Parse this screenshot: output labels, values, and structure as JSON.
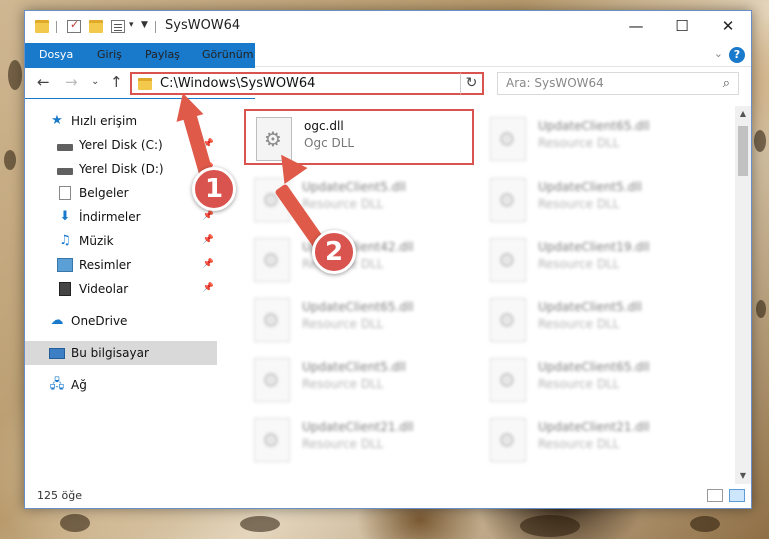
{
  "window": {
    "title": "SysWOW64",
    "controls": {
      "minimize": "—",
      "maximize": "☐",
      "close": "✕"
    }
  },
  "ribbon": {
    "tabs": [
      "Dosya",
      "Giriş",
      "Paylaş",
      "Görünüm"
    ],
    "help": "?"
  },
  "navigation": {
    "address": "C:\\Windows\\SysWOW64",
    "search_placeholder": "Ara: SysWOW64"
  },
  "sidebar": {
    "items": [
      {
        "label": "Hızlı erişim",
        "icon": "star-icon"
      },
      {
        "label": "Yerel Disk (C:)",
        "icon": "drive-icon"
      },
      {
        "label": "Yerel Disk (D:)",
        "icon": "drive-icon"
      },
      {
        "label": "Belgeler",
        "icon": "documents-icon"
      },
      {
        "label": "İndirmeler",
        "icon": "downloads-icon"
      },
      {
        "label": "Müzik",
        "icon": "music-icon"
      },
      {
        "label": "Resimler",
        "icon": "pictures-icon"
      },
      {
        "label": "Videolar",
        "icon": "videos-icon"
      },
      {
        "label": "OneDrive",
        "icon": "cloud-icon"
      },
      {
        "label": "Bu bilgisayar",
        "icon": "computer-icon"
      },
      {
        "label": "Ağ",
        "icon": "network-icon"
      }
    ]
  },
  "files": [
    {
      "name": "ogc.dll",
      "type": "Ogc DLL"
    },
    {
      "name": "UpdateClient65.dll",
      "type": "Resource DLL"
    },
    {
      "name": "UpdateClient5.dll",
      "type": "Resource DLL"
    },
    {
      "name": "UpdateClient5.dll",
      "type": "Resource DLL"
    },
    {
      "name": "UpdateClient42.dll",
      "type": "Resource DLL"
    },
    {
      "name": "UpdateClient19.dll",
      "type": "Resource DLL"
    },
    {
      "name": "UpdateClient65.dll",
      "type": "Resource DLL"
    },
    {
      "name": "UpdateClient5.dll",
      "type": "Resource DLL"
    },
    {
      "name": "UpdateClient5.dll",
      "type": "Resource DLL"
    },
    {
      "name": "UpdateClient65.dll",
      "type": "Resource DLL"
    },
    {
      "name": "UpdateClient21.dll",
      "type": "Resource DLL"
    },
    {
      "name": "UpdateClient21.dll",
      "type": "Resource DLL"
    }
  ],
  "status": {
    "count": "125 öğe"
  },
  "annotations": {
    "badge1": "1",
    "badge2": "2",
    "color": "#d9534f"
  }
}
